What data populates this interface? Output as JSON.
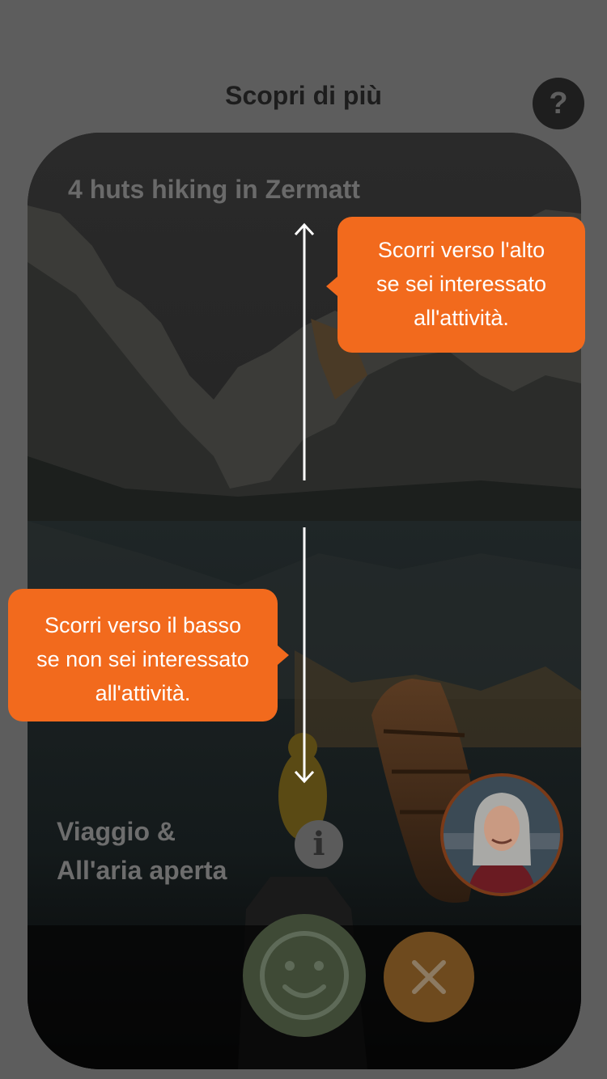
{
  "header": {
    "title": "Scopri di più"
  },
  "help": {
    "icon": "question-mark-icon",
    "glyph": "?"
  },
  "card": {
    "title": "4 huts hiking in Zermatt",
    "category_line1": "Viaggio &",
    "category_line2": "All'aria aperta",
    "info_glyph": "i"
  },
  "tooltips": {
    "up": [
      "Scorri verso l'alto",
      "se sei interessato",
      "all'attività."
    ],
    "down": [
      "Scorri verso il basso",
      "se non sei interessato",
      "all'attività."
    ]
  },
  "colors": {
    "overlay_background": "#5d5d5d",
    "tooltip": "#f26a1d",
    "like_button": "#3f4a36",
    "dislike_button": "#6e4a1e"
  }
}
